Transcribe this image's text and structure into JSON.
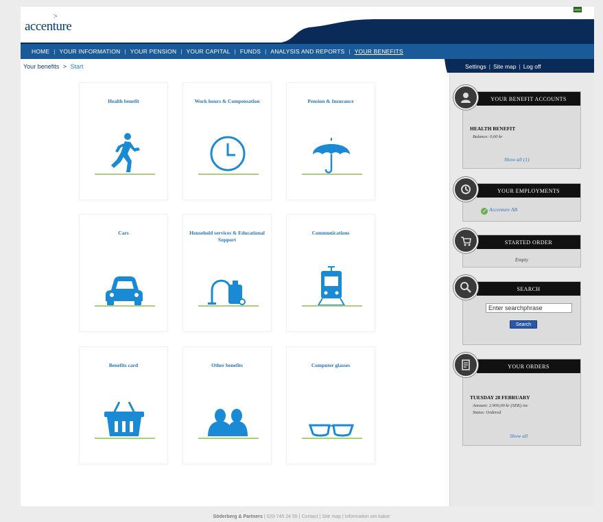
{
  "brand": {
    "logo_text": "accenture",
    "logo_mark": ">"
  },
  "nav": {
    "items": [
      {
        "label": "HOME"
      },
      {
        "label": "YOUR INFORMATION"
      },
      {
        "label": "YOUR PENSION"
      },
      {
        "label": "YOUR CAPITAL"
      },
      {
        "label": "FUNDS"
      },
      {
        "label": "ANALYSIS AND REPORTS"
      },
      {
        "label": "YOUR BENEFITS",
        "active": true
      }
    ],
    "separator": "|"
  },
  "breadcrumb": {
    "root": "Your benefits",
    "separator": ">",
    "current": "Start"
  },
  "user_links": {
    "settings": "Settings",
    "site_map": "Site map",
    "log_off": "Log off",
    "separator": "|"
  },
  "tiles": [
    {
      "title": "Health benefit",
      "icon": "runner-icon"
    },
    {
      "title": "Work hours & Compensation",
      "icon": "clock-icon"
    },
    {
      "title": "Pension & Insurance",
      "icon": "umbrella-icon"
    },
    {
      "title": "Cars",
      "icon": "car-icon"
    },
    {
      "title": "Household services & Educational Support",
      "icon": "vacuum-cleaner-icon"
    },
    {
      "title": "Communications",
      "icon": "train-icon"
    },
    {
      "title": "Benefits card",
      "icon": "basket-icon"
    },
    {
      "title": "Other benefits",
      "icon": "people-icon"
    },
    {
      "title": "Computer glasses",
      "icon": "glasses-icon"
    }
  ],
  "widgets": {
    "benefit_accounts": {
      "title": "YOUR BENEFIT ACCOUNTS",
      "account_name": "HEALTH BENEFIT",
      "balance": "Balance: 0,00 kr",
      "show_all": "Show all (1)"
    },
    "employments": {
      "title": "YOUR EMPLOYMENTS",
      "employer": "Accenture AB"
    },
    "started_order": {
      "title": "STARTED ORDER",
      "status": "Empty"
    },
    "search": {
      "title": "SEARCH",
      "value": "Enter searchphrase",
      "button": "Search"
    },
    "orders": {
      "title": "YOUR ORDERS",
      "date": "TUESDAY 28 FEBRUARY",
      "amount": "Amount: 2.900,00 kr (SEK) inc",
      "status": "Status: Ordered",
      "show_all": "Show all"
    }
  },
  "footer": {
    "company": "Söderberg & Partners",
    "phone": "020-745 24 55",
    "contact": "Contact",
    "site_map": "Site map",
    "cookies": "Information om kakor",
    "separator": "|"
  },
  "colors": {
    "brand_navy": "#0b3d6b",
    "nav_blue": "#1a5a98",
    "icon_blue": "#1a8ad4",
    "accent_green": "#a8cf7a"
  }
}
